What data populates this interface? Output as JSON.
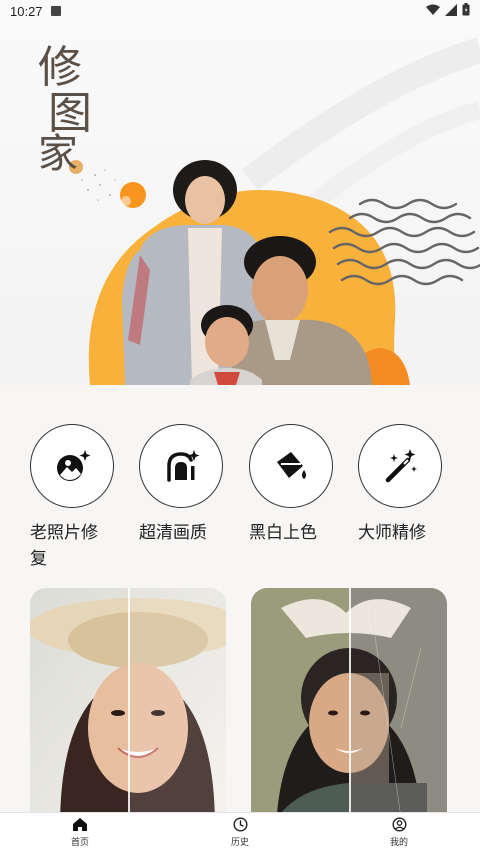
{
  "status_bar": {
    "time": "10:27"
  },
  "hero": {
    "title_chars": [
      "修",
      "图",
      "家"
    ]
  },
  "features": [
    {
      "label": "老照片修复",
      "icon": "photo-restore-icon"
    },
    {
      "label": "超清画质",
      "icon": "hd-enhance-icon"
    },
    {
      "label": "黑白上色",
      "icon": "paint-bucket-icon"
    },
    {
      "label": "大师精修",
      "icon": "magic-wand-icon"
    }
  ],
  "cards": [
    {
      "name": "portrait-sample-card"
    },
    {
      "name": "colorize-sample-card"
    }
  ],
  "bottom_nav": [
    {
      "label": "首页",
      "icon": "home-icon",
      "active": true
    },
    {
      "label": "历史",
      "icon": "clock-icon",
      "active": false
    },
    {
      "label": "我的",
      "icon": "profile-icon",
      "active": false
    }
  ],
  "colors": {
    "accent_orange": "#f7a93a",
    "text_dark": "#222222",
    "title_brown": "#5a5048"
  }
}
